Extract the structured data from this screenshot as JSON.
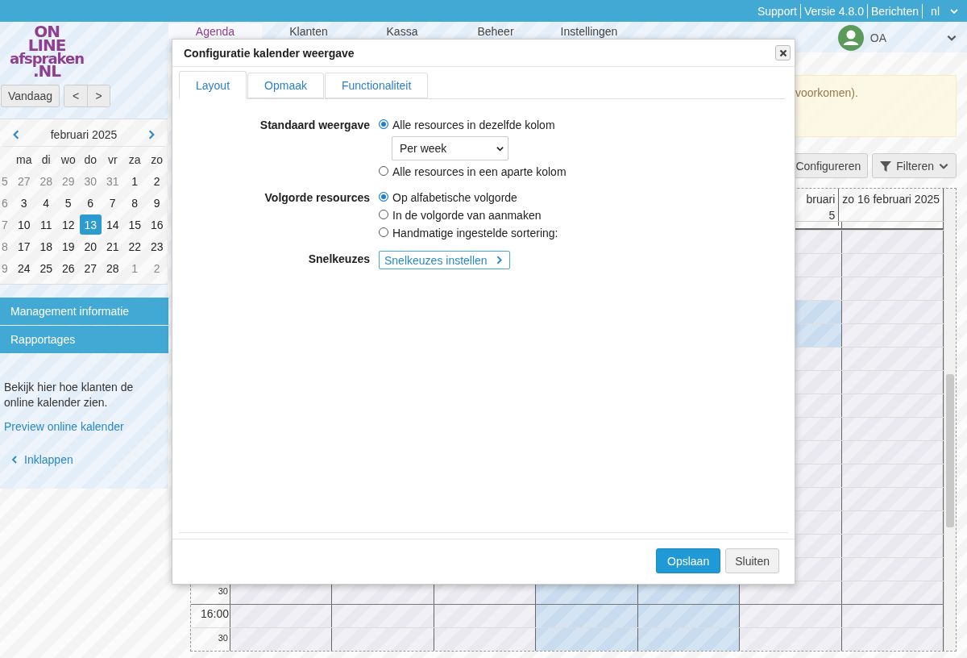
{
  "logo": [
    "ON",
    "LINE",
    "afspraken",
    ".NL"
  ],
  "top_links": [
    "Support",
    "Versie 4.8.0",
    "Berichten"
  ],
  "language": "nl",
  "nav_tabs": [
    {
      "label": "Agenda",
      "selected": true
    },
    {
      "label": "Klanten",
      "selected": false
    },
    {
      "label": "Kassa",
      "selected": false
    },
    {
      "label": "Beheer",
      "selected": false
    },
    {
      "label": "Instellingen",
      "selected": false
    }
  ],
  "user": {
    "initials": "OA"
  },
  "sidebar": {
    "today_button": "Vandaag",
    "prev_button": "<",
    "next_button": ">",
    "mini_calendar": {
      "month": "februari 2025",
      "weekdays": [
        "ma",
        "di",
        "wo",
        "do",
        "vr",
        "za",
        "zo"
      ],
      "weeks": [
        {
          "number": "5",
          "days": [
            {
              "day": "27",
              "outside": true,
              "selected": false
            },
            {
              "day": "28",
              "outside": true,
              "selected": false
            },
            {
              "day": "29",
              "outside": true,
              "selected": false
            },
            {
              "day": "30",
              "outside": true,
              "selected": false
            },
            {
              "day": "31",
              "outside": true,
              "selected": false
            },
            {
              "day": "1",
              "outside": false,
              "selected": false
            },
            {
              "day": "2",
              "outside": false,
              "selected": false
            }
          ]
        },
        {
          "number": "6",
          "days": [
            {
              "day": "3",
              "outside": false,
              "selected": false
            },
            {
              "day": "4",
              "outside": false,
              "selected": false
            },
            {
              "day": "5",
              "outside": false,
              "selected": false
            },
            {
              "day": "6",
              "outside": false,
              "selected": false
            },
            {
              "day": "7",
              "outside": false,
              "selected": false
            },
            {
              "day": "8",
              "outside": false,
              "selected": false
            },
            {
              "day": "9",
              "outside": false,
              "selected": false
            }
          ]
        },
        {
          "number": "7",
          "days": [
            {
              "day": "10",
              "outside": false,
              "selected": false
            },
            {
              "day": "11",
              "outside": false,
              "selected": false
            },
            {
              "day": "12",
              "outside": false,
              "selected": false
            },
            {
              "day": "13",
              "outside": false,
              "selected": true
            },
            {
              "day": "14",
              "outside": false,
              "selected": false
            },
            {
              "day": "15",
              "outside": false,
              "selected": false
            },
            {
              "day": "16",
              "outside": false,
              "selected": false
            }
          ]
        },
        {
          "number": "8",
          "days": [
            {
              "day": "17",
              "outside": false,
              "selected": false
            },
            {
              "day": "18",
              "outside": false,
              "selected": false
            },
            {
              "day": "19",
              "outside": false,
              "selected": false
            },
            {
              "day": "20",
              "outside": false,
              "selected": false
            },
            {
              "day": "21",
              "outside": false,
              "selected": false
            },
            {
              "day": "22",
              "outside": false,
              "selected": false
            },
            {
              "day": "23",
              "outside": false,
              "selected": false
            }
          ]
        },
        {
          "number": "9",
          "days": [
            {
              "day": "24",
              "outside": false,
              "selected": false
            },
            {
              "day": "25",
              "outside": false,
              "selected": false
            },
            {
              "day": "26",
              "outside": false,
              "selected": false
            },
            {
              "day": "27",
              "outside": false,
              "selected": false
            },
            {
              "day": "28",
              "outside": false,
              "selected": false
            },
            {
              "day": "1",
              "outside": true,
              "selected": false
            },
            {
              "day": "2",
              "outside": true,
              "selected": false
            }
          ]
        }
      ]
    },
    "menu": [
      "Management informatie",
      "Rapportages"
    ],
    "info_text": "Bekijk hier hoe klanten de online kalender zien.",
    "preview_link": "Preview online kalender",
    "collapse_link": "Inklappen"
  },
  "notice": "voorkomen).",
  "toolbar": {
    "configure_button": "Configureren",
    "filter_button": "Filteren"
  },
  "calendar": {
    "headers": [
      [
        "bruari",
        "5"
      ],
      [
        "zo 16 februari 2025"
      ]
    ],
    "rows": [
      {
        "highlighted": [
          false,
          false
        ]
      },
      {
        "highlighted": [
          false,
          false
        ]
      },
      {
        "highlighted": [
          false,
          false
        ]
      },
      {
        "highlighted": [
          true,
          false
        ]
      },
      {
        "highlighted": [
          true,
          false
        ]
      },
      {
        "highlighted": [
          false,
          false
        ]
      },
      {
        "highlighted": [
          false,
          false
        ]
      },
      {
        "highlighted": [
          false,
          false
        ]
      },
      {
        "highlighted": [
          false,
          false
        ]
      },
      {
        "highlighted": [
          false,
          false
        ]
      },
      {
        "highlighted": [
          false,
          false
        ]
      },
      {
        "highlighted": [
          false,
          false
        ]
      },
      {
        "highlighted": [
          false,
          false
        ]
      },
      {
        "highlighted": [
          false,
          false
        ]
      },
      {
        "highlighted": [
          false,
          false
        ]
      },
      {
        "label": "30",
        "kind": "half",
        "highlighted": [
          false,
          false,
          false,
          true,
          true,
          false,
          false
        ]
      },
      {
        "label": "16:00",
        "kind": "hour",
        "highlighted": [
          false,
          false,
          false,
          true,
          true,
          false,
          false
        ]
      },
      {
        "label": "30",
        "kind": "half",
        "highlighted": [
          false,
          false,
          false,
          true,
          true,
          false,
          false
        ]
      }
    ]
  },
  "dialog": {
    "title": "Configuratie kalender weergave",
    "tabs": [
      {
        "label": "Layout",
        "selected": true
      },
      {
        "label": "Opmaak",
        "selected": false
      },
      {
        "label": "Functionaliteit",
        "selected": false
      }
    ],
    "form": [
      {
        "label": "Standaard weergave",
        "options": [
          {
            "kind": "radio",
            "label": "Alle resources in dezelfde kolom",
            "selected": true
          },
          {
            "kind": "select",
            "value": "Per week"
          },
          {
            "kind": "radio",
            "label": "Alle resources in een aparte kolom",
            "selected": false
          }
        ]
      },
      {
        "label": "Volgorde resources",
        "options": [
          {
            "kind": "radio",
            "label": "Op alfabetische volgorde",
            "selected": true
          },
          {
            "kind": "radio",
            "label": "In de volgorde van aanmaken",
            "selected": false
          },
          {
            "kind": "radio",
            "label": "Handmatige ingestelde sortering:",
            "selected": false
          }
        ]
      },
      {
        "label": "Snelkeuzes",
        "options": [
          {
            "kind": "button",
            "label": "Snelkeuzes instellen"
          }
        ]
      }
    ],
    "save_button": "Opslaan",
    "close_button": "Sluiten"
  }
}
